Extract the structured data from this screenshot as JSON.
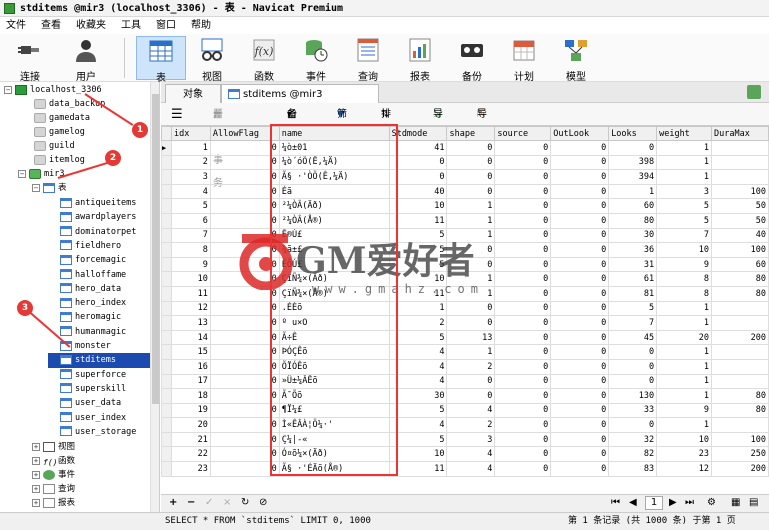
{
  "window": {
    "title": "stditems @mir3 (localhost_3306) - 表 - Navicat Premium"
  },
  "menu": [
    "文件",
    "查看",
    "收藏夹",
    "工具",
    "窗口",
    "帮助"
  ],
  "toolbar": [
    {
      "id": "connect",
      "label": "连接",
      "icon": "connect-icon"
    },
    {
      "id": "user",
      "label": "用户",
      "icon": "user-icon"
    },
    {
      "id": "table",
      "label": "表",
      "icon": "table-icon",
      "active": true
    },
    {
      "id": "view",
      "label": "视图",
      "icon": "glasses-icon"
    },
    {
      "id": "function",
      "label": "函数",
      "icon": "function-icon"
    },
    {
      "id": "event",
      "label": "事件",
      "icon": "clock-icon"
    },
    {
      "id": "query",
      "label": "查询",
      "icon": "query-icon"
    },
    {
      "id": "report",
      "label": "报表",
      "icon": "report-icon"
    },
    {
      "id": "backup",
      "label": "备份",
      "icon": "backup-icon"
    },
    {
      "id": "schedule",
      "label": "计划",
      "icon": "calendar-icon"
    },
    {
      "id": "model",
      "label": "模型",
      "icon": "model-icon"
    }
  ],
  "sidebar": {
    "connection": "localhost_3306",
    "databases_before": [
      "data_backup",
      "gamedata",
      "gamelog",
      "guild",
      "itemlog"
    ],
    "active_db": "mir3",
    "tables_group": "表",
    "tables": [
      "antiqueitems",
      "awardplayers",
      "dominatorpet",
      "fieldhero",
      "forcemagic",
      "halloffame",
      "hero_data",
      "hero_index",
      "heromagic",
      "humanmagic",
      "monster",
      "stditems",
      "superforce",
      "superskill",
      "user_data",
      "user_index",
      "user_storage"
    ],
    "selected_table": "stditems",
    "groups_after": [
      "视图",
      "函数",
      "事件",
      "查询",
      "报表"
    ]
  },
  "tabs": {
    "objects": "对象",
    "table_tab": "stditems @mir3 (localhost..."
  },
  "subtoolbar": {
    "start_tx": "开始事务",
    "memo": "备注",
    "filter": "筛选",
    "sort": "排序",
    "import": "导入",
    "export": "导出"
  },
  "grid": {
    "columns": [
      "idx",
      "AllowFlag",
      "name",
      "Stdmode",
      "shape",
      "source",
      "OutLook",
      "Looks",
      "weight",
      "DuraMax"
    ],
    "rows": [
      [
        1,
        0,
        "¼ò±01",
        41,
        0,
        0,
        0,
        0,
        1,
        ""
      ],
      [
        2,
        0,
        "¼ò´óÖ(Ê,¼Ä)",
        0,
        0,
        0,
        0,
        398,
        1,
        ""
      ],
      [
        3,
        0,
        "Ã§ ·'ÒÖ(Ê,¼Ä)",
        0,
        0,
        0,
        0,
        394,
        1,
        ""
      ],
      [
        4,
        0,
        "Éã",
        40,
        0,
        0,
        0,
        1,
        3,
        100
      ],
      [
        5,
        0,
        "²¼ÒÂ(Äð)",
        10,
        1,
        0,
        0,
        60,
        5,
        50
      ],
      [
        6,
        0,
        "²¼ÒÂ(Å®)",
        11,
        1,
        0,
        0,
        80,
        5,
        50
      ],
      [
        7,
        0,
        "Ê®Ú£",
        5,
        1,
        0,
        0,
        30,
        7,
        40
      ],
      [
        8,
        0,
        "¾ã±£",
        5,
        0,
        0,
        0,
        36,
        10,
        100
      ],
      [
        9,
        0,
        "ÊÕÚ£",
        5,
        0,
        0,
        0,
        31,
        9,
        60
      ],
      [
        10,
        0,
        "ÇïÑ¾×(Äð)",
        10,
        1,
        0,
        0,
        61,
        8,
        80
      ],
      [
        11,
        0,
        "ÇïÑ¾×(Å®)",
        11,
        1,
        0,
        0,
        81,
        8,
        80
      ],
      [
        12,
        0,
        ".ÉÈõ",
        1,
        0,
        0,
        0,
        5,
        1,
        ""
      ],
      [
        13,
        0,
        "º u×O",
        2,
        0,
        0,
        0,
        7,
        1,
        ""
      ],
      [
        14,
        0,
        "Ã÷Ê",
        5,
        13,
        0,
        0,
        45,
        20,
        200
      ],
      [
        15,
        0,
        "ÞÓÇÊõ",
        4,
        1,
        0,
        0,
        0,
        1,
        ""
      ],
      [
        16,
        0,
        "ÕÏÓÊõ",
        4,
        2,
        0,
        0,
        0,
        1,
        ""
      ],
      [
        17,
        0,
        "»Ü±¼ÂÊõ",
        4,
        0,
        0,
        0,
        0,
        1,
        ""
      ],
      [
        18,
        0,
        "Ã¯Õõ",
        30,
        0,
        0,
        0,
        130,
        1,
        80
      ],
      [
        19,
        0,
        "¶Ï¼£",
        5,
        4,
        0,
        0,
        33,
        9,
        80
      ],
      [
        20,
        0,
        "Ì«ÊÂÀ¦Ö¼·'",
        4,
        2,
        0,
        0,
        0,
        1,
        ""
      ],
      [
        21,
        0,
        "Ç¼|-«",
        5,
        3,
        0,
        0,
        32,
        10,
        100
      ],
      [
        22,
        0,
        "Ó¤õ¼×(Äð)",
        10,
        4,
        0,
        0,
        82,
        23,
        250
      ],
      [
        23,
        0,
        "Ã§ ·'ÉÄõ(Å®)",
        11,
        4,
        0,
        0,
        83,
        12,
        200
      ]
    ]
  },
  "nav": {
    "page": "1"
  },
  "status": {
    "sql": "SELECT * FROM `stditems` LIMIT 0, 1000",
    "record": "第 1 条记录 (共 1000 条) 于第 1 页"
  },
  "annotations": {
    "one": "1",
    "two": "2",
    "three": "3"
  },
  "watermark": {
    "text": "GM爱好者",
    "url": "www.gmahz.com"
  },
  "colors": {
    "selection": "#1c4bb0",
    "annotation": "#e33333",
    "active_tool": "#cde4fb"
  }
}
